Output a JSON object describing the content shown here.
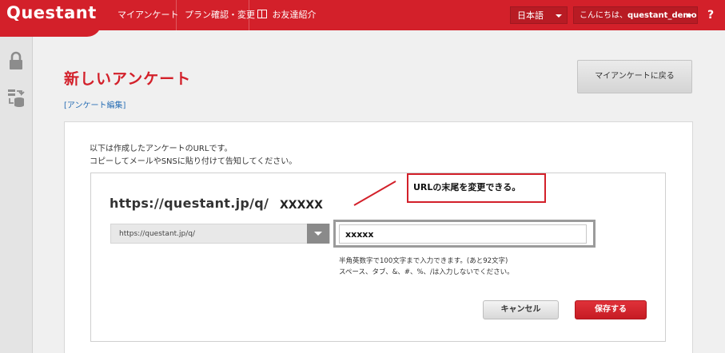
{
  "app": {
    "logo": "Questant",
    "brand_color": "#d3202a"
  },
  "nav": {
    "items": [
      {
        "label": "マイアンケート"
      },
      {
        "label": "プラン確認・変更"
      },
      {
        "label": "お友達紹介",
        "icon": "gift-icon"
      }
    ],
    "language": "日本語",
    "greeting_prefix": "こんにちは、",
    "username": "questant_demo",
    "greeting_suffix": "さん",
    "help": "?"
  },
  "sidebar": {
    "icons": [
      "lock-icon",
      "transfer-icon"
    ]
  },
  "page": {
    "title": "新しいアンケート",
    "back_button": "マイアンケートに戻る",
    "breadcrumb": "[アンケート編集]"
  },
  "panel": {
    "description_line1": "以下は作成したアンケートのURLです。",
    "description_line2": "コピーしてメールやSNSに貼り付けて告知してください。",
    "url_base": "https://questant.jp/q/",
    "url_suffix": "XXXXX",
    "domain_select_value": "https://questant.jp/q/",
    "suffix_input_value": "xxxxx",
    "hint_line1": "半角英数字で100文字まで入力できます。(あと92文字)",
    "hint_line2": "スペース、タブ、&、#、%、/は入力しないでください。",
    "cancel_button": "キャンセル",
    "save_button": "保存する"
  },
  "annotation": {
    "callout_text": "URLの末尾を変更できる。"
  }
}
